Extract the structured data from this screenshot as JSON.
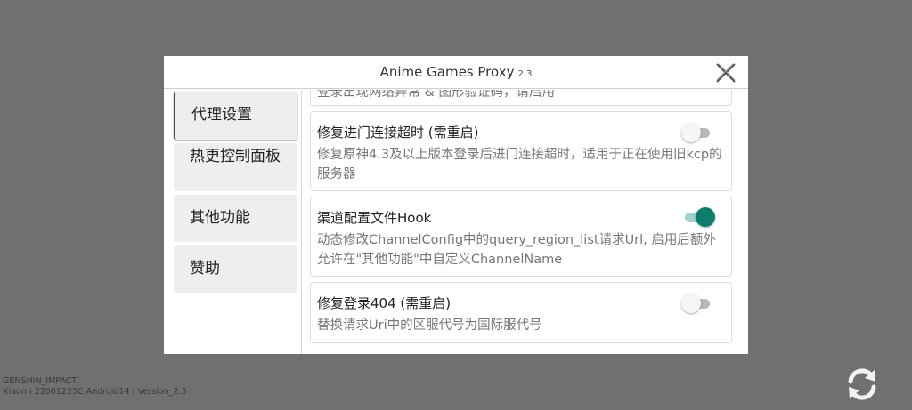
{
  "dialog": {
    "title": "Anime Games Proxy",
    "version": "2.3"
  },
  "sidebar": {
    "items": [
      {
        "label": "代理设置"
      },
      {
        "label": "热更控制面板"
      },
      {
        "label": "其他功能"
      },
      {
        "label": "赞助"
      }
    ]
  },
  "settings": [
    {
      "title": "",
      "description": "登录出现网络异常 & 图形验证码，请启用"
    },
    {
      "title": "修复进门连接超时 (需重启)",
      "description": "修复原神4.3及以上版本登录后进门连接超时，适用于正在使用旧kcp的服务器",
      "enabled": false
    },
    {
      "title": "渠道配置文件Hook",
      "description": "动态修改ChannelConfig中的query_region_list请求Url, 启用后额外允许在\"其他功能\"中自定义ChannelName",
      "enabled": true
    },
    {
      "title": "修复登录404 (需重启)",
      "description": "替换请求Uri中的区服代号为国际服代号",
      "enabled": false
    }
  ],
  "footer": {
    "game": "GENSHIN_IMPACT",
    "device": "Xiaomi 22061225C Android14 | Version_2.3"
  },
  "colors": {
    "accent": "#0d7e6e",
    "backdrop": "#707070"
  },
  "icons": {
    "close": "close-icon",
    "refresh": "refresh-icon"
  }
}
